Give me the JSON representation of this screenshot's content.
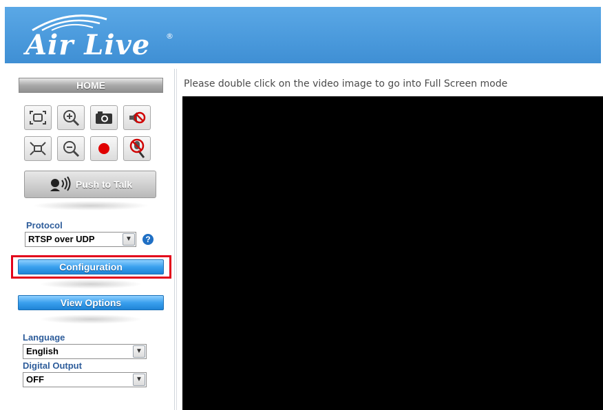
{
  "header": {
    "logo_text": "Air Live",
    "logo_reg": "®"
  },
  "sidebar": {
    "home_label": "HOME",
    "controls_row1": [
      "fit-screen-icon",
      "zoom-in-icon",
      "snapshot-camera-icon",
      "speaker-mute-icon"
    ],
    "controls_row2": [
      "full-size-icon",
      "zoom-out-icon",
      "record-icon",
      "microphone-mute-icon"
    ],
    "push_to_talk_label": "Push to Talk",
    "protocol": {
      "label": "Protocol",
      "selected": "RTSP over UDP",
      "help": "?"
    },
    "configuration_label": "Configuration",
    "view_options_label": "View Options",
    "language": {
      "label": "Language",
      "selected": "English"
    },
    "digital_output": {
      "label": "Digital Output",
      "selected": "OFF"
    }
  },
  "main": {
    "hint": "Please double click on the video image to go into Full Screen mode"
  },
  "colors": {
    "header_blue": "#4a9ce0",
    "button_blue": "#2b93e3",
    "label_blue": "#2d5c9a",
    "highlight_red": "#e2001a",
    "video_bg": "#000000"
  }
}
